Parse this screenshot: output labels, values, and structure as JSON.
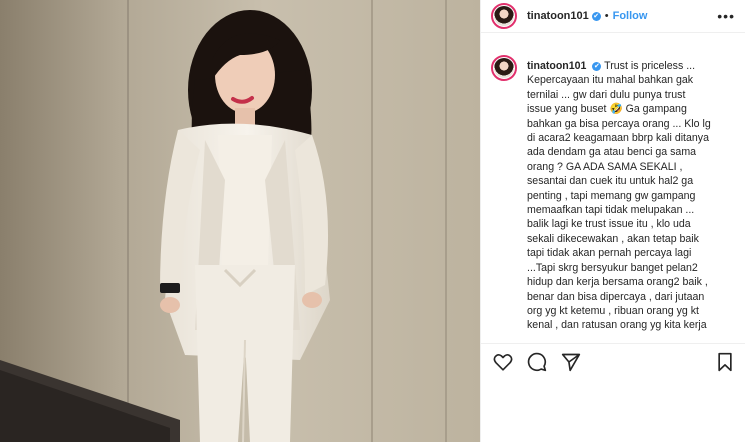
{
  "header": {
    "username": "tinatoon101",
    "verified_mark": "✔",
    "separator": "•",
    "follow_label": "Follow",
    "more_label": "•••"
  },
  "caption": {
    "username": "tinatoon101",
    "verified_mark": "✔",
    "lines": [
      "Trust is priceless ...",
      "Kepercayaan itu mahal bahkan gak",
      "ternilai ... gw dari dulu punya trust",
      "issue yang buset 🤣 Ga gampang",
      "bahkan ga bisa percaya orang ... Klo lg",
      "di acara2 keagamaan bbrp kali ditanya",
      "ada dendam ga atau benci ga sama",
      "orang ? GA ADA SAMA SEKALI ,",
      "sesantai dan cuek itu untuk hal2 ga",
      "penting , tapi memang gw gampang",
      "memaafkan tapi tidak melupakan ...",
      "balik lagi ke trust issue itu , klo uda",
      "sekali dikecewakan , akan tetap baik",
      "tapi tidak akan pernah percaya lagi",
      "...Tapi skrg bersyukur banget pelan2",
      "hidup dan kerja bersama orang2 baik ,",
      "benar dan bisa dipercaya , dari jutaan",
      "org yg kt ketemu , ribuan orang yg kt",
      "kenal , dan ratusan orang yg kita kerja"
    ]
  },
  "icons": {
    "like": "heart-icon",
    "comment": "comment-icon",
    "share": "share-icon",
    "save": "bookmark-icon"
  },
  "colors": {
    "accent": "#3897f0",
    "story_ring": "#e1306c",
    "text": "#262626"
  }
}
